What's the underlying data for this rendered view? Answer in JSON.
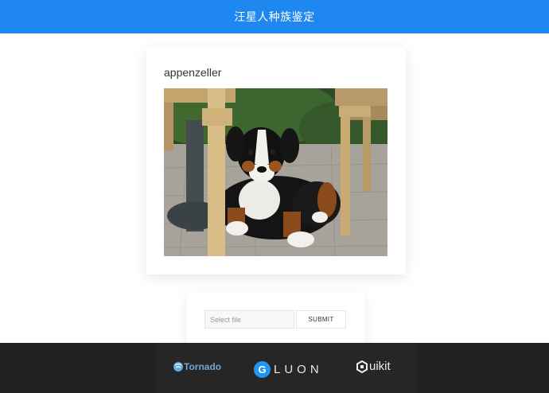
{
  "header": {
    "title": "汪星人种族鉴定"
  },
  "result": {
    "label": "appenzeller"
  },
  "upload": {
    "placeholder": "Select file",
    "submit_label": "SUBMIT"
  },
  "footer": {
    "logos": [
      {
        "name": "Tornado",
        "icon": "tornado-icon"
      },
      {
        "name": "LUON",
        "icon": "gluon-g-icon",
        "badge": "G"
      },
      {
        "name": "uikit",
        "icon": "uikit-icon"
      }
    ]
  },
  "colors": {
    "header": "#1e87f0",
    "footer": "#222222",
    "tornado": "#6aa8d8",
    "gluon": "#2196f3"
  }
}
